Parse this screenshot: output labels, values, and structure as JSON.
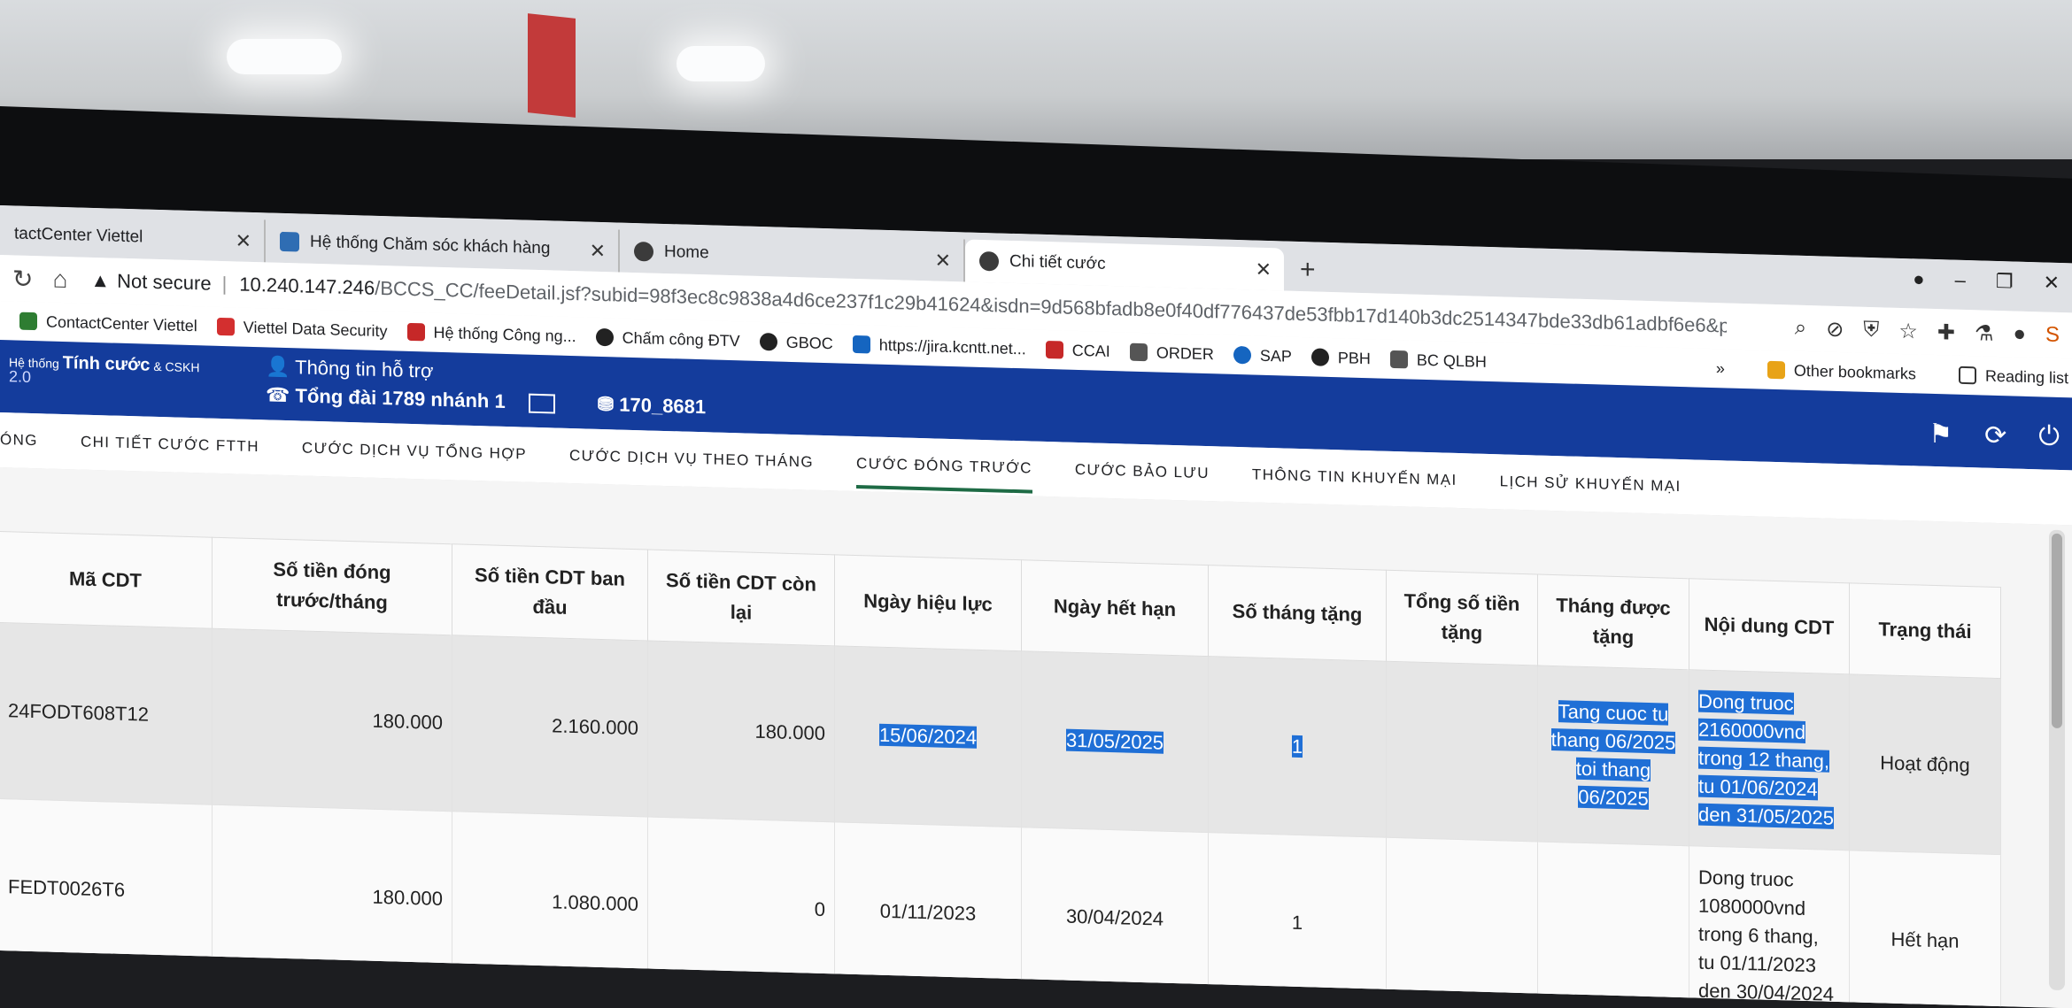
{
  "browser": {
    "tabs": [
      {
        "label": "tactCenter Viettel",
        "active": false
      },
      {
        "label": "Hệ thống Chăm sóc khách hàng",
        "active": false
      },
      {
        "label": "Home",
        "active": false
      },
      {
        "label": "Chi tiết cước",
        "active": true
      }
    ],
    "new_tab": "+",
    "not_secure": "Not secure",
    "url_host": "10.240.147.246",
    "url_path": "/BCCS_CC/feeDetail.jsf?subid=98f3ec8c9838a4d6ce237f1c29b41624&isdn=9d568bfadb8e0f40df776437de53fbb17d140b3dc2514347bde33db61adbf6e6&pro...",
    "bookmarks": [
      {
        "label": "ContactCenter Viettel",
        "color": "#2e7d32"
      },
      {
        "label": "Viettel Data Security",
        "color": "#d32f2f"
      },
      {
        "label": "Hệ thống Công ng...",
        "color": "#c62828"
      },
      {
        "label": "Chấm công ĐTV",
        "color": "#222222"
      },
      {
        "label": "GBOC",
        "color": "#222222"
      },
      {
        "label": "https://jira.kcntt.net...",
        "color": "#1565c0"
      },
      {
        "label": "CCAI",
        "color": "#c62828"
      },
      {
        "label": "ORDER",
        "color": "#555555"
      },
      {
        "label": "SAP",
        "color": "#1565c0"
      },
      {
        "label": "PBH",
        "color": "#222222"
      },
      {
        "label": "BC QLBH",
        "color": "#555555"
      }
    ],
    "more_bookmarks": "»",
    "other_bookmarks": "Other bookmarks",
    "reading_list": "Reading list"
  },
  "app": {
    "brand_small": "Hệ thống",
    "brand_main": "Tính cước",
    "brand_tail": "& CSKH",
    "version": "2.0",
    "support_title": "Thông tin hỗ trợ",
    "hotline": "Tổng đài 1789 nhánh 1",
    "agent_code": "170_8681",
    "menu": [
      {
        "label": "ÓNG",
        "active": false
      },
      {
        "label": "CHI TIẾT CƯỚC FTTH",
        "active": false
      },
      {
        "label": "CƯỚC DỊCH VỤ TỔNG HỢP",
        "active": false
      },
      {
        "label": "CƯỚC DỊCH VỤ THEO THÁNG",
        "active": false
      },
      {
        "label": "CƯỚC ĐÓNG TRƯỚC",
        "active": true
      },
      {
        "label": "CƯỚC BẢO LƯU",
        "active": false
      },
      {
        "label": "THÔNG TIN KHUYẾN MẠI",
        "active": false
      },
      {
        "label": "LỊCH SỬ KHUYẾN MẠI",
        "active": false
      }
    ]
  },
  "table": {
    "headers": [
      "Mã CDT",
      "Số tiền đóng trước/tháng",
      "Số tiền CDT ban đầu",
      "Số tiền CDT còn lại",
      "Ngày hiệu lực",
      "Ngày hết hạn",
      "Số tháng tặng",
      "Tổng số tiền tặng",
      "Tháng được tặng",
      "Nội dung CDT",
      "Trạng thái"
    ],
    "rows": [
      {
        "ma_cdt": "24FODT608T12",
        "tien_thang": "180.000",
        "tien_ban_dau": "2.160.000",
        "tien_con_lai": "180.000",
        "ngay_hieu_luc": "15/06/2024",
        "ngay_het_han": "31/05/2025",
        "so_thang_tang": "1",
        "tong_tien_tang": "",
        "thang_duoc_tang": "Tang cuoc tu thang 06/2025 toi thang 06/2025",
        "noi_dung": "Dong truoc 2160000vnd trong 12 thang, tu 01/06/2024 den 31/05/2025",
        "trang_thai": "Hoạt động"
      },
      {
        "ma_cdt": "FEDT0026T6",
        "tien_thang": "180.000",
        "tien_ban_dau": "1.080.000",
        "tien_con_lai": "0",
        "ngay_hieu_luc": "01/11/2023",
        "ngay_het_han": "30/04/2024",
        "so_thang_tang": "1",
        "tong_tien_tang": "",
        "thang_duoc_tang": "",
        "noi_dung": "Dong truoc 1080000vnd trong 6 thang, tu 01/11/2023 den 30/04/2024",
        "trang_thai": "Hết hạn"
      }
    ]
  },
  "colors": {
    "header_blue": "#143c9c",
    "selection": "#1f6fd6",
    "active_tab_underline": "#1e6b45"
  }
}
